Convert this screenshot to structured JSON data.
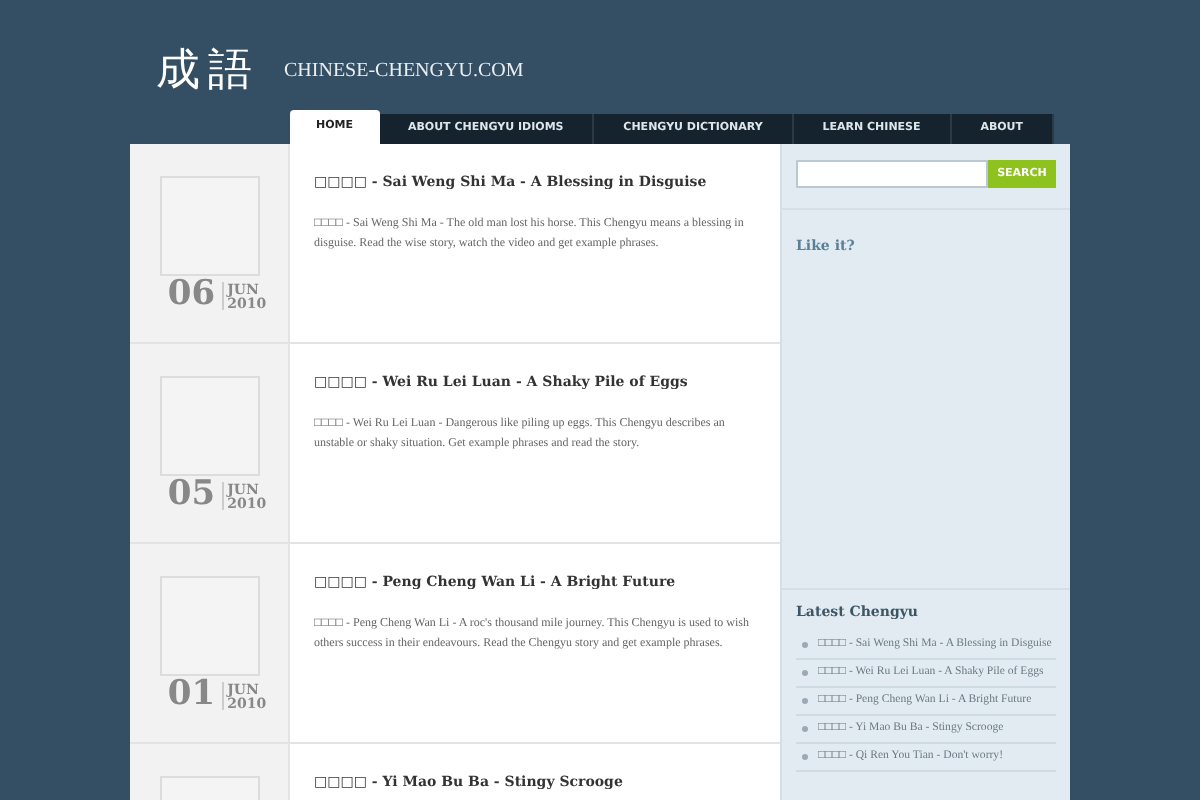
{
  "logo": {
    "mark": "成語",
    "site": "CHINESE-CHENGYU.COM"
  },
  "nav": [
    {
      "label": "HOME",
      "selected": true
    },
    {
      "label": "ABOUT CHENGYU IDIOMS",
      "selected": false
    },
    {
      "label": "CHENGYU DICTIONARY",
      "selected": false
    },
    {
      "label": "LEARN CHINESE",
      "selected": false
    },
    {
      "label": "ABOUT",
      "selected": false
    }
  ],
  "posts": [
    {
      "day": "06",
      "month": "JUN",
      "year": "2010",
      "title": "□□□□ - Sai Weng Shi Ma - A Blessing in Disguise",
      "excerpt": "□□□□ - Sai Weng Shi Ma - The old man lost his horse. This Chengyu means a blessing in disguise. Read the wise story, watch the video and get example phrases."
    },
    {
      "day": "05",
      "month": "JUN",
      "year": "2010",
      "title": "□□□□ - Wei Ru Lei Luan - A Shaky Pile of Eggs",
      "excerpt": "□□□□ - Wei Ru Lei Luan - Dangerous like piling up eggs. This Chengyu describes an unstable or shaky situation. Get example phrases and read the story."
    },
    {
      "day": "01",
      "month": "JUN",
      "year": "2010",
      "title": "□□□□ - Peng Cheng Wan Li - A Bright Future",
      "excerpt": "□□□□ - Peng Cheng Wan Li - A roc's thousand mile journey. This Chengyu is used to wish others success in their endeavours. Read the Chengyu story and get example phrases."
    },
    {
      "title": "□□□□ - Yi Mao Bu Ba - Stingy Scrooge"
    }
  ],
  "sidebar": {
    "search_button": "SEARCH",
    "like_heading": "Like it?",
    "latest_heading": "Latest Chengyu",
    "latest": [
      "□□□□ - Sai Weng Shi Ma - A Blessing in Disguise",
      "□□□□ - Wei Ru Lei Luan - A Shaky Pile of Eggs",
      "□□□□ - Peng Cheng Wan Li - A Bright Future",
      "□□□□ - Yi Mao Bu Ba - Stingy Scrooge",
      "□□□□ - Qi Ren You Tian - Don't worry!"
    ]
  }
}
